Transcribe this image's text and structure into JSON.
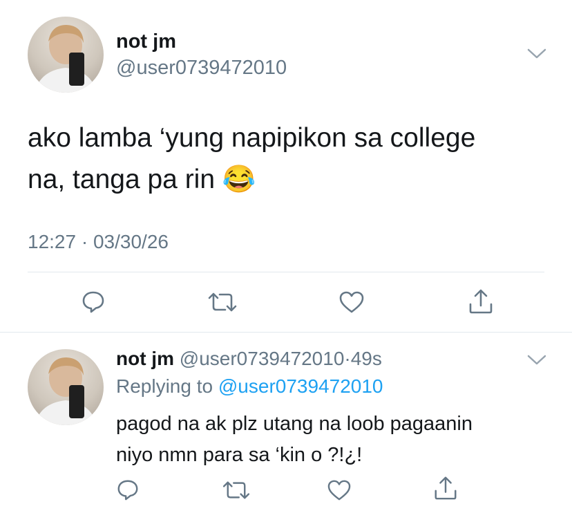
{
  "main_tweet": {
    "display_name": "not jm",
    "handle": "@user0739472010",
    "text": "ako lamba ‘yung napipikon sa college\nna, tanga pa rin 😂",
    "time": "12:27",
    "separator": "·",
    "date": "03/30/26",
    "icons": [
      "reply-icon",
      "retweet-icon",
      "like-icon",
      "share-icon"
    ]
  },
  "reply_tweet": {
    "display_name": "not jm",
    "handle": "@user0739472010",
    "dot": "·",
    "age": "49s",
    "replying_prefix": "Replying to",
    "replying_handle": "@user0739472010",
    "text": "pagod na ak plz utang na loob pagaanin\nniyo nmn para sa ‘kin o ?!¿!",
    "icons": [
      "reply-icon",
      "retweet-icon",
      "like-icon",
      "share-icon"
    ]
  },
  "colors": {
    "text": "#14171a",
    "secondary": "#657786",
    "link": "#1da1f2",
    "divider": "#e1e8ed",
    "icon": "#657786"
  }
}
